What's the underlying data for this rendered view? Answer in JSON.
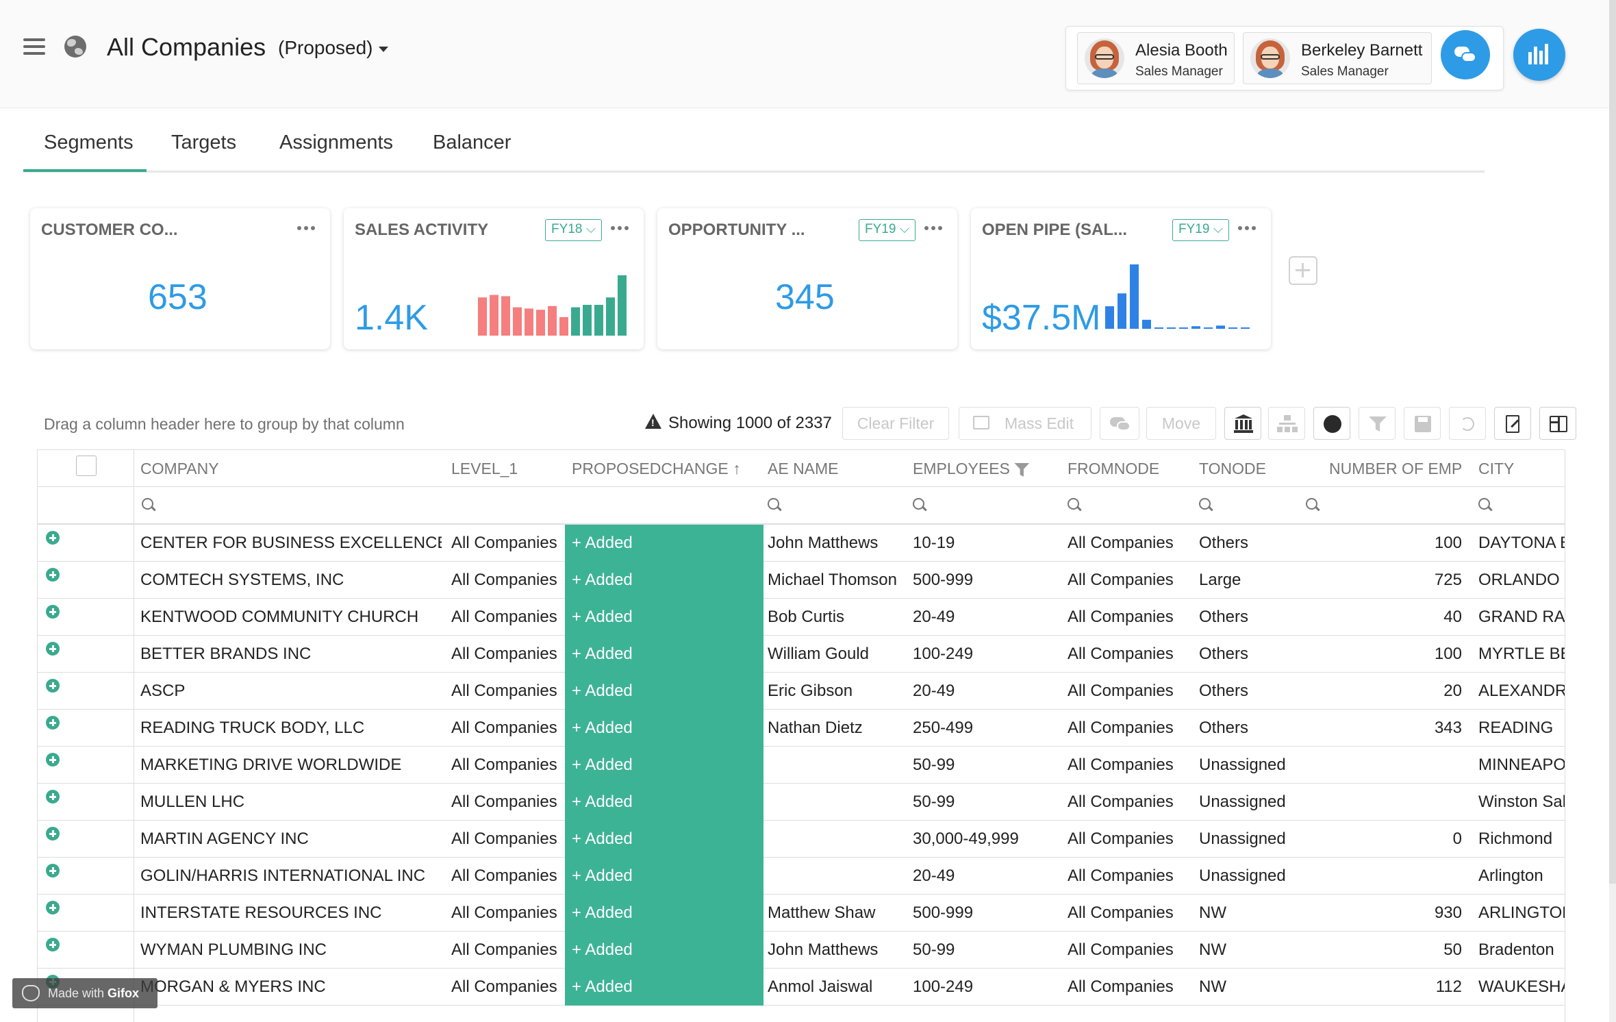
{
  "header": {
    "title": "All Companies",
    "scenario": "(Proposed)",
    "users": [
      {
        "name": "Alesia Booth",
        "role": "Sales Manager"
      },
      {
        "name": "Berkeley Barnett",
        "role": "Sales Manager"
      }
    ]
  },
  "tabs": [
    {
      "label": "Segments",
      "active": true
    },
    {
      "label": "Targets",
      "active": false
    },
    {
      "label": "Assignments",
      "active": false
    },
    {
      "label": "Balancer",
      "active": false
    }
  ],
  "cards": [
    {
      "title": "CUSTOMER CO...",
      "value": "653",
      "fy": ""
    },
    {
      "title": "SALES ACTIVITY",
      "value": "1.4K",
      "fy": "FY18"
    },
    {
      "title": "OPPORTUNITY ...",
      "value": "345",
      "fy": "FY19"
    },
    {
      "title": "OPEN PIPE (SAL...",
      "value": "$37.5M",
      "fy": "FY19"
    }
  ],
  "sparklines": {
    "sales_activity": {
      "values": [
        0.62,
        0.66,
        0.64,
        0.46,
        0.44,
        0.42,
        0.48,
        0.3,
        0.46,
        0.5,
        0.5,
        0.62,
        0.98
      ],
      "colors": [
        "#f57e7e",
        "#f57e7e",
        "#f57e7e",
        "#f57e7e",
        "#f57e7e",
        "#f57e7e",
        "#f57e7e",
        "#f57e7e",
        "#3aaa8f",
        "#3aaa8f",
        "#3aaa8f",
        "#3aaa8f",
        "#3aaa8f"
      ]
    },
    "open_pipe": {
      "values": [
        0.35,
        0.55,
        1.0,
        0.14,
        0.02,
        0.02,
        0.02,
        0.04,
        0.02,
        0.05,
        0.02,
        0.02
      ],
      "color": "#2e82e6"
    }
  },
  "toolbar": {
    "group_hint": "Drag a column header here to group by that column",
    "showing": "Showing 1000 of 2337",
    "clear_filter": "Clear Filter",
    "mass_edit": "Mass Edit",
    "move": "Move"
  },
  "columns": [
    "COMPANY",
    "LEVEL_1",
    "PROPOSEDCHANGE",
    "AE NAME",
    "EMPLOYEES",
    "FROMNODE",
    "TONODE",
    "NUMBER OF EMP",
    "CITY"
  ],
  "rows": [
    {
      "company": "CENTER FOR BUSINESS EXCELLENCE",
      "level": "All Companies",
      "change": "+ Added",
      "ae": "John Matthews",
      "emp": "10-19",
      "from": "All Companies",
      "to": "Others",
      "num": "100",
      "city": "DAYTONA B"
    },
    {
      "company": "COMTECH SYSTEMS, INC",
      "level": "All Companies",
      "change": "+ Added",
      "ae": "Michael Thomson",
      "emp": "500-999",
      "from": "All Companies",
      "to": "Large",
      "num": "725",
      "city": "ORLANDO"
    },
    {
      "company": "KENTWOOD COMMUNITY CHURCH",
      "level": "All Companies",
      "change": "+ Added",
      "ae": "Bob Curtis",
      "emp": "20-49",
      "from": "All Companies",
      "to": "Others",
      "num": "40",
      "city": "GRAND RAF"
    },
    {
      "company": "BETTER BRANDS INC",
      "level": "All Companies",
      "change": "+ Added",
      "ae": "William Gould",
      "emp": "100-249",
      "from": "All Companies",
      "to": "Others",
      "num": "100",
      "city": "MYRTLE BE"
    },
    {
      "company": "ASCP",
      "level": "All Companies",
      "change": "+ Added",
      "ae": "Eric Gibson",
      "emp": "20-49",
      "from": "All Companies",
      "to": "Others",
      "num": "20",
      "city": "ALEXANDRI"
    },
    {
      "company": "READING TRUCK BODY, LLC",
      "level": "All Companies",
      "change": "+ Added",
      "ae": "Nathan Dietz",
      "emp": "250-499",
      "from": "All Companies",
      "to": "Others",
      "num": "343",
      "city": "READING"
    },
    {
      "company": "MARKETING DRIVE WORLDWIDE",
      "level": "All Companies",
      "change": "+ Added",
      "ae": "",
      "emp": "50-99",
      "from": "All Companies",
      "to": "Unassigned",
      "num": "",
      "city": "MINNEAPOL"
    },
    {
      "company": "MULLEN LHC",
      "level": "All Companies",
      "change": "+ Added",
      "ae": "",
      "emp": "50-99",
      "from": "All Companies",
      "to": "Unassigned",
      "num": "",
      "city": "Winston Sal"
    },
    {
      "company": "MARTIN AGENCY INC",
      "level": "All Companies",
      "change": "+ Added",
      "ae": "",
      "emp": "30,000-49,999",
      "from": "All Companies",
      "to": "Unassigned",
      "num": "0",
      "city": "Richmond"
    },
    {
      "company": "GOLIN/HARRIS INTERNATIONAL INC",
      "level": "All Companies",
      "change": "+ Added",
      "ae": "",
      "emp": "20-49",
      "from": "All Companies",
      "to": "Unassigned",
      "num": "",
      "city": "Arlington"
    },
    {
      "company": "INTERSTATE RESOURCES INC",
      "level": "All Companies",
      "change": "+ Added",
      "ae": "Matthew Shaw",
      "emp": "500-999",
      "from": "All Companies",
      "to": "NW",
      "num": "930",
      "city": "ARLINGTON"
    },
    {
      "company": "WYMAN PLUMBING INC",
      "level": "All Companies",
      "change": "+ Added",
      "ae": "John Matthews",
      "emp": "50-99",
      "from": "All Companies",
      "to": "NW",
      "num": "50",
      "city": "Bradenton"
    },
    {
      "company": "MORGAN & MYERS INC",
      "level": "All Companies",
      "change": "+ Added",
      "ae": "Anmol Jaiswal",
      "emp": "100-249",
      "from": "All Companies",
      "to": "NW",
      "num": "112",
      "city": "WAUKESHA"
    }
  ],
  "watermark": {
    "prefix": "Made with ",
    "brand": "Gifox"
  }
}
